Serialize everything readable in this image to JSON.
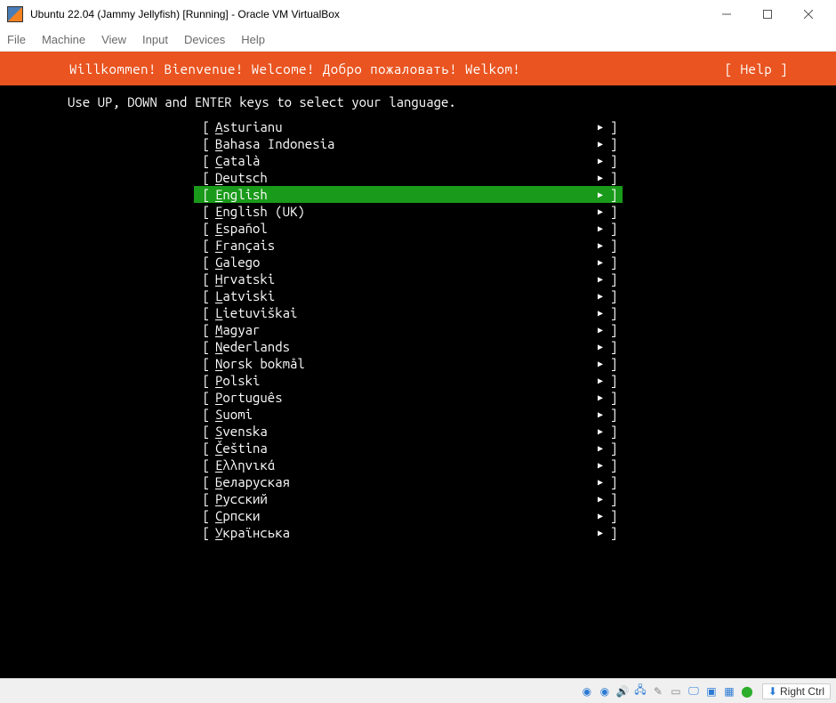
{
  "window": {
    "title": "Ubuntu 22.04 (Jammy Jellyfish) [Running] - Oracle VM VirtualBox"
  },
  "menu": {
    "file": "File",
    "machine": "Machine",
    "view": "View",
    "input": "Input",
    "devices": "Devices",
    "help": "Help"
  },
  "installer": {
    "greeting": "Willkommen! Bienvenue! Welcome! Добро пожаловать! Welkom!",
    "help_label": "[ Help ]",
    "instruction": "Use UP, DOWN and ENTER keys to select your language.",
    "selected_index": 4,
    "languages": [
      "Asturianu",
      "Bahasa Indonesia",
      "Català",
      "Deutsch",
      "English",
      "English (UK)",
      "Español",
      "Français",
      "Galego",
      "Hrvatski",
      "Latviski",
      "Lietuviškai",
      "Magyar",
      "Nederlands",
      "Norsk bokmål",
      "Polski",
      "Português",
      "Suomi",
      "Svenska",
      "Čeština",
      "Ελληνικά",
      "Беларуская",
      "Русский",
      "Српски",
      "Українська"
    ]
  },
  "status": {
    "hostkey": "Right Ctrl"
  }
}
